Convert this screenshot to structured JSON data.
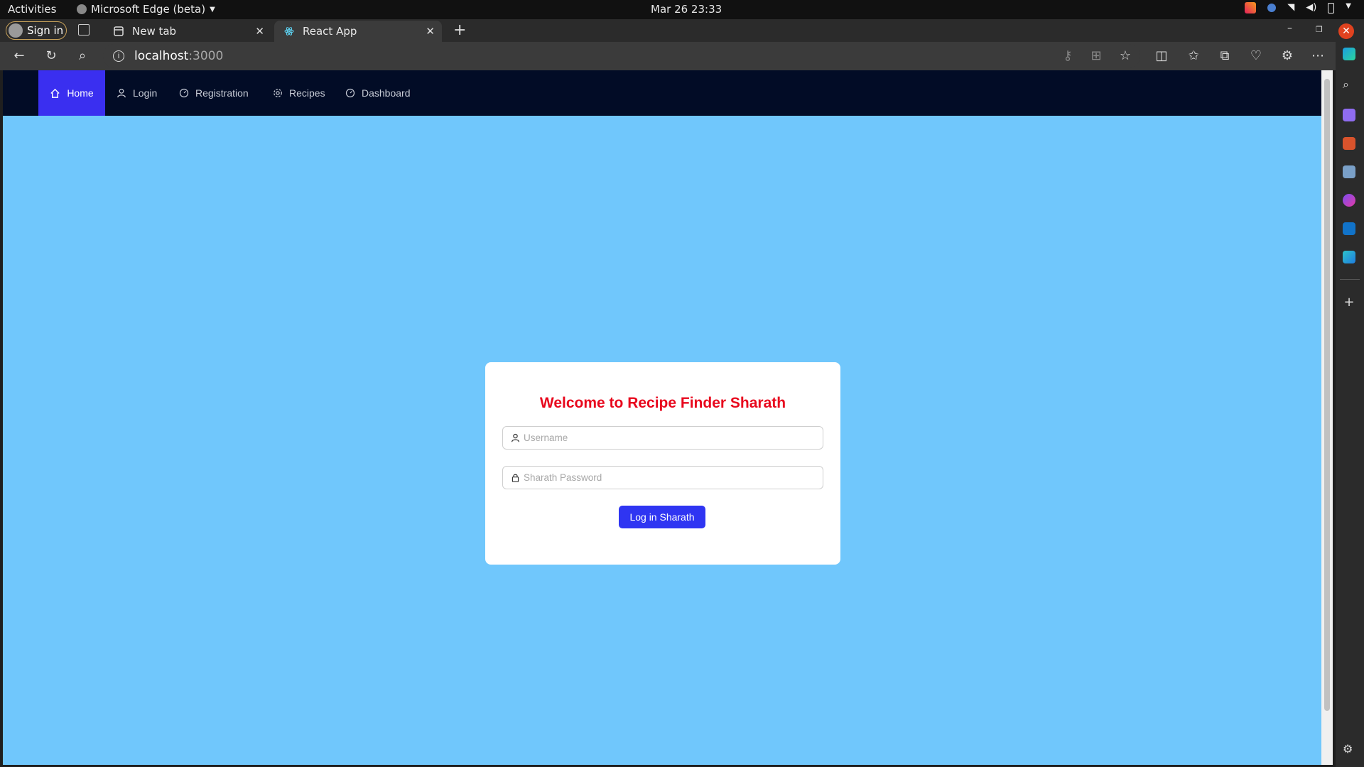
{
  "os": {
    "activities": "Activities",
    "app_name": "Microsoft Edge (beta)",
    "clock": "Mar 26  23:33"
  },
  "browser": {
    "sign_in": "Sign in",
    "tabs": [
      {
        "title": "New tab",
        "icon": "newtab-icon"
      },
      {
        "title": "React App",
        "icon": "react-icon"
      }
    ],
    "address": {
      "host": "localhost",
      "port": ":3000"
    },
    "accent": "#c8a25a"
  },
  "site": {
    "nav": [
      {
        "label": "Home",
        "icon": "home-icon",
        "active": true
      },
      {
        "label": "Login",
        "icon": "user-icon",
        "active": false
      },
      {
        "label": "Registration",
        "icon": "dashboard-icon",
        "active": false
      },
      {
        "label": "Recipes",
        "icon": "gear-icon",
        "active": false
      },
      {
        "label": "Dashboard",
        "icon": "dashboard-icon",
        "active": false
      }
    ],
    "colors": {
      "page_bg": "#70c7fc",
      "nav_bg": "#020c26",
      "active_nav": "#3a2ff0",
      "title": "#e8071d",
      "button": "#2f35f2"
    },
    "login": {
      "title": "Welcome to Recipe Finder Sharath",
      "username_placeholder": "Username",
      "password_placeholder": "Sharath Password",
      "button": "Log in Sharath"
    }
  }
}
